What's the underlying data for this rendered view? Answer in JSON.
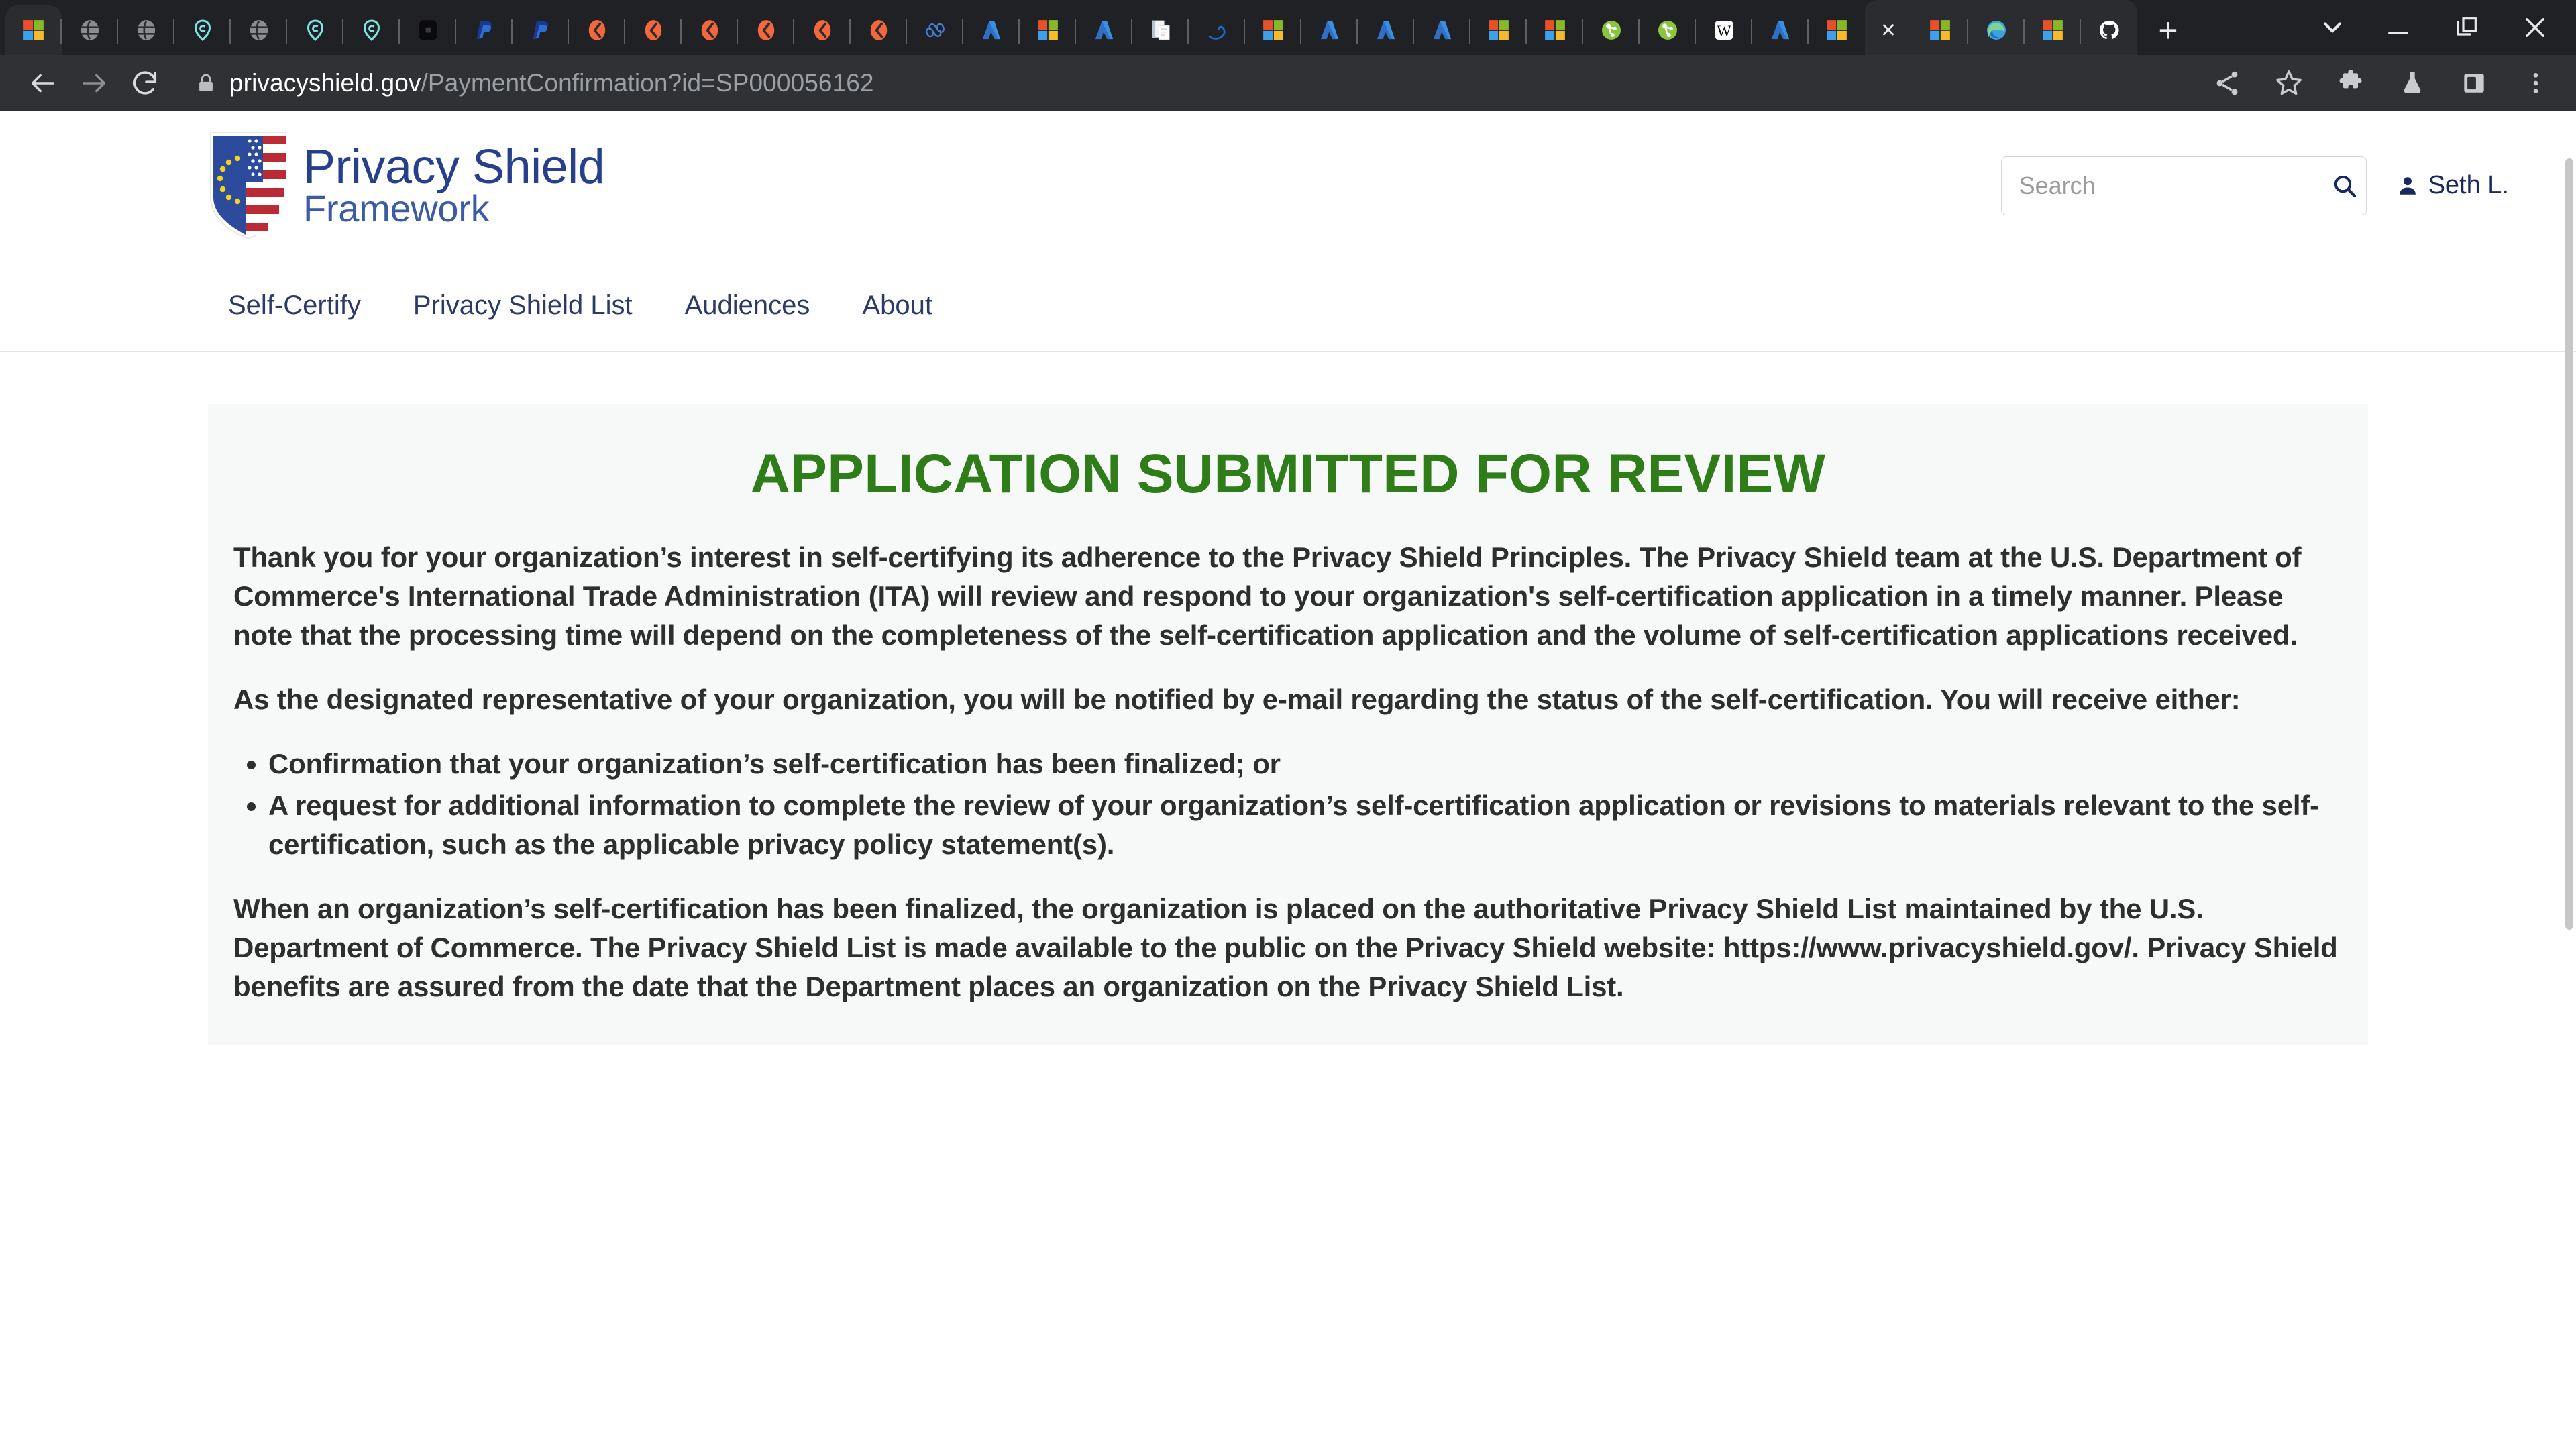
{
  "browser": {
    "window_controls": [
      {
        "name": "tab-search-chevron",
        "glyph": "chevron-down-icon"
      },
      {
        "name": "minimize",
        "glyph": "minimize-icon"
      },
      {
        "name": "maximize",
        "glyph": "maximize-icon"
      },
      {
        "name": "close",
        "glyph": "close-icon"
      }
    ],
    "tabs": [
      {
        "icon": "microsoft-logo-icon"
      },
      {
        "icon": "globe-gray-icon"
      },
      {
        "icon": "globe-gray-icon"
      },
      {
        "icon": "teal-g-icon"
      },
      {
        "icon": "globe-gray-icon"
      },
      {
        "icon": "teal-g-icon"
      },
      {
        "icon": "teal-g-icon"
      },
      {
        "icon": "dark-square-icon"
      },
      {
        "icon": "paypal-icon"
      },
      {
        "icon": "paypal-icon"
      },
      {
        "icon": "orange-chevron-icon"
      },
      {
        "icon": "orange-chevron-icon"
      },
      {
        "icon": "orange-chevron-icon"
      },
      {
        "icon": "orange-chevron-icon"
      },
      {
        "icon": "orange-chevron-icon"
      },
      {
        "icon": "orange-chevron-icon"
      },
      {
        "icon": "infinity-blue-icon"
      },
      {
        "icon": "azure-a-icon"
      },
      {
        "icon": "microsoft-logo-icon"
      },
      {
        "icon": "azure-a-icon"
      },
      {
        "icon": "document-stack-icon"
      },
      {
        "icon": "dolphin-icon"
      },
      {
        "icon": "microsoft-logo-icon"
      },
      {
        "icon": "azure-a-icon"
      },
      {
        "icon": "azure-a-icon"
      },
      {
        "icon": "azure-a-icon"
      },
      {
        "icon": "microsoft-logo-icon"
      },
      {
        "icon": "microsoft-logo-icon"
      },
      {
        "icon": "green-molecule-icon"
      },
      {
        "icon": "green-molecule-icon"
      },
      {
        "icon": "wikipedia-w-icon"
      },
      {
        "icon": "azure-a-icon"
      },
      {
        "icon": "microsoft-logo-icon"
      }
    ],
    "active_tab_close_label": "×",
    "tabs_after_active": [
      {
        "icon": "microsoft-logo-icon"
      },
      {
        "icon": "edge-icon"
      },
      {
        "icon": "microsoft-logo-icon"
      },
      {
        "icon": "github-icon"
      }
    ],
    "new_tab_label": "+",
    "nav": {
      "back": "back-arrow-icon",
      "forward": "forward-arrow-icon",
      "reload": "reload-icon"
    },
    "address": {
      "lock": "lock-icon",
      "domain": "privacyshield.gov",
      "path": "/PaymentConfirmation?id=SP000056162"
    },
    "toolbar_icons": [
      {
        "name": "share-icon"
      },
      {
        "name": "bookmark-star-icon"
      },
      {
        "name": "extensions-puzzle-icon"
      },
      {
        "name": "experiments-flask-icon"
      },
      {
        "name": "side-panel-icon"
      },
      {
        "name": "more-menu-icon"
      }
    ]
  },
  "site": {
    "logo": {
      "line1": "Privacy Shield",
      "line2": "Framework",
      "alt": "privacy-shield-framework-logo"
    },
    "search": {
      "placeholder": "Search",
      "value": "",
      "icon": "search-icon"
    },
    "user": {
      "name": "Seth L.",
      "icon": "user-avatar-icon"
    },
    "nav_items": [
      {
        "label": "Self-Certify"
      },
      {
        "label": "Privacy Shield List"
      },
      {
        "label": "Audiences"
      },
      {
        "label": "About"
      }
    ]
  },
  "main": {
    "title": "APPLICATION SUBMITTED FOR REVIEW",
    "title_color": "#2e7d18",
    "paragraph_1": "Thank you for your organization’s interest in self-certifying its adherence to the Privacy Shield Principles. The Privacy Shield team at the U.S. Department of Commerce's International Trade Administration (ITA) will review and respond to your organization's self-certification application in a timely manner. Please note that the processing time will depend on the completeness of the self-certification application and the volume of self-certification applications received.",
    "paragraph_2": "As the designated representative of your organization, you will be notified by e-mail regarding the status of the self-certification. You will receive either:",
    "bullets": [
      "Confirmation that your organization’s self-certification has been finalized; or",
      "A request for additional information to complete the review of your organization’s self-certification application or revisions to materials relevant to the self-certification, such as the applicable privacy policy statement(s)."
    ],
    "paragraph_3": "When an organization’s self-certification has been finalized, the organization is placed on the authoritative Privacy Shield List maintained by the U.S. Department of Commerce. The Privacy Shield List is made available to the public on the Privacy Shield website: https://www.privacyshield.gov/. Privacy Shield benefits are assured from the date that the Department places an organization on the Privacy Shield List."
  }
}
